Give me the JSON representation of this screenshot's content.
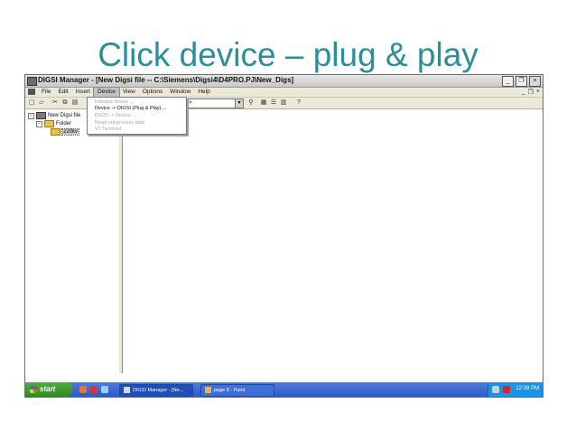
{
  "slide": {
    "title": "Click device – plug & play"
  },
  "window": {
    "title": "DIGSI Manager - [New Digsi file -- C:\\Siemens\\Digsi4\\D4PRO.PJ\\New_Digs]"
  },
  "menubar": {
    "items": [
      "File",
      "Edit",
      "Insert",
      "Device",
      "View",
      "Options",
      "Window",
      "Help"
    ],
    "active": "Device"
  },
  "toolbar": {
    "combo_value": "e >"
  },
  "device_menu": {
    "items": [
      {
        "label": "Initialize device ...",
        "enabled": false
      },
      {
        "label": "Device -> DIGSI (Plug & Play)....",
        "enabled": true
      },
      {
        "label": "DIGSI -> Device ...",
        "enabled": false
      },
      {
        "label": "Read out process data",
        "enabled": false
      },
      {
        "label": "V2 Terminal",
        "enabled": false
      }
    ]
  },
  "tree": {
    "root": "New Digsi file",
    "folder": "Folder",
    "device": "220kv"
  },
  "taskbar": {
    "start_label": "start",
    "tasks": [
      "DIGSI Manager - [Ne...",
      "page 8 - Paint"
    ],
    "clock": "12:39 PM"
  },
  "colors": {
    "title": "#2a8f9c",
    "taskbar": "#2d5bc6",
    "start": "#2f8a25"
  }
}
